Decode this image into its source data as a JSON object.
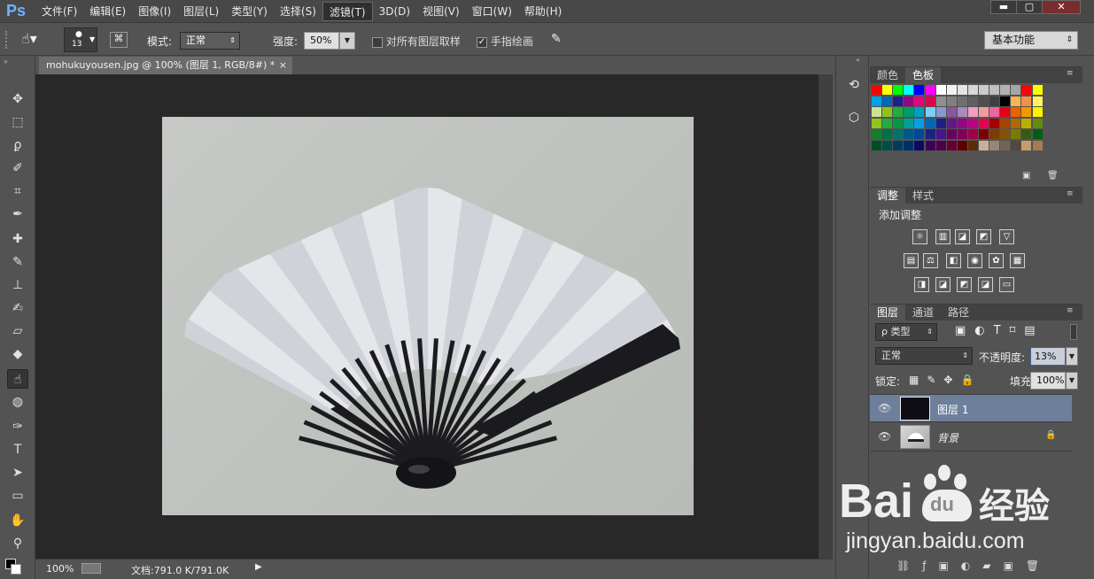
{
  "app": {
    "logo": "Ps"
  },
  "menu": [
    "文件(F)",
    "编辑(E)",
    "图像(I)",
    "图层(L)",
    "类型(Y)",
    "选择(S)",
    "滤镜(T)",
    "3D(D)",
    "视图(V)",
    "窗口(W)",
    "帮助(H)"
  ],
  "menu_active": "滤镜(T)",
  "window_buttons": {
    "minimize": "▬",
    "maximize": "▢",
    "close": "✕"
  },
  "options": {
    "brush_size": "13",
    "mode_label": "模式:",
    "mode_value": "正常",
    "strength_label": "强度:",
    "strength_value": "50%",
    "sample_all_label": "对所有图层取样",
    "finger_paint_label": "手指绘画",
    "workspace": "基本功能"
  },
  "document": {
    "tab_title": "mohukuyousen.jpg @ 100% (图层 1, RGB/8#) *",
    "close": "×"
  },
  "status": {
    "zoom": "100%",
    "doc_info": "文档:791.0 K/791.0K"
  },
  "panels": {
    "color": {
      "tabs": [
        "颜色",
        "色板"
      ],
      "active": 1
    },
    "adjust": {
      "tabs": [
        "调整",
        "样式"
      ],
      "active": 0,
      "title": "添加调整"
    },
    "layers": {
      "tabs": [
        "图层",
        "通道",
        "路径"
      ],
      "active": 0,
      "filter_label": "ρ 类型",
      "blend_mode": "正常",
      "opacity_label": "不透明度:",
      "opacity_value": "13%",
      "lock_label": "锁定:",
      "fill_label": "填充:",
      "fill_value": "100%",
      "items": [
        {
          "name": "图层 1",
          "selected": true
        },
        {
          "name": "背景",
          "selected": false,
          "locked": true
        }
      ]
    }
  },
  "watermark": {
    "brand_a": "Bai",
    "brand_b": "du",
    "brand_cn": "经验",
    "url": "jingyan.baidu.com"
  },
  "swatch_rows": [
    [
      "#ff0000",
      "#ffff00",
      "#00ff00",
      "#00ffff",
      "#0000ff",
      "#ff00ff",
      "#ffffff",
      "#f2f2f2",
      "#e5e5e5",
      "#d8d8d8",
      "#cccccc",
      "#bfbfbf",
      "#b2b2b2",
      "#a5a5a5",
      "#ff0000",
      "#ffff00"
    ],
    [
      "#00a0e9",
      "#0068b7",
      "#1d2088",
      "#920783",
      "#e4007f",
      "#e5004f",
      "#8f8f8f",
      "#7f7f7f",
      "#6f6f6f",
      "#5f5f5f",
      "#4f4f4f",
      "#3f3f3f",
      "#000000",
      "#f8b551",
      "#f19149",
      "#fff45c"
    ],
    [
      "#cce198",
      "#8fc31f",
      "#22ac38",
      "#009b6b",
      "#00a0c1",
      "#7ecef4",
      "#8c97cb",
      "#8957a1",
      "#aa89bd",
      "#f19ec2",
      "#f29c9f",
      "#ea68a2",
      "#e60012",
      "#eb6100",
      "#f39800",
      "#fff100"
    ],
    [
      "#8fc31f",
      "#22ac38",
      "#009944",
      "#009e96",
      "#00a0e9",
      "#0068b7",
      "#1d2088",
      "#601986",
      "#920783",
      "#be0081",
      "#e5004f",
      "#a40000",
      "#a84200",
      "#ac6a00",
      "#b8b000",
      "#638c0b"
    ],
    [
      "#1a7b30",
      "#007140",
      "#00736d",
      "#005982",
      "#00479d",
      "#1a237e",
      "#4a148c",
      "#6a005f",
      "#7e0059",
      "#9e004a",
      "#7d0000",
      "#7b3e00",
      "#815500",
      "#7c7a00",
      "#375b14",
      "#005e15"
    ],
    [
      "#004d25",
      "#004e4b",
      "#003d61",
      "#002f6c",
      "#100964",
      "#3f0058",
      "#500047",
      "#640034",
      "#5f0000",
      "#5c2d00",
      "#c7b299",
      "#998675",
      "#736357",
      "#534741",
      "#c69c6d",
      "#a67c52"
    ]
  ],
  "tools": [
    "move",
    "marquee",
    "lasso",
    "quick-select",
    "crop",
    "eyedropper",
    "healing",
    "brush",
    "stamp",
    "history-brush",
    "eraser",
    "paint-bucket",
    "smudge",
    "sponge",
    "pen",
    "type",
    "path-select",
    "rectangle",
    "hand",
    "zoom"
  ]
}
